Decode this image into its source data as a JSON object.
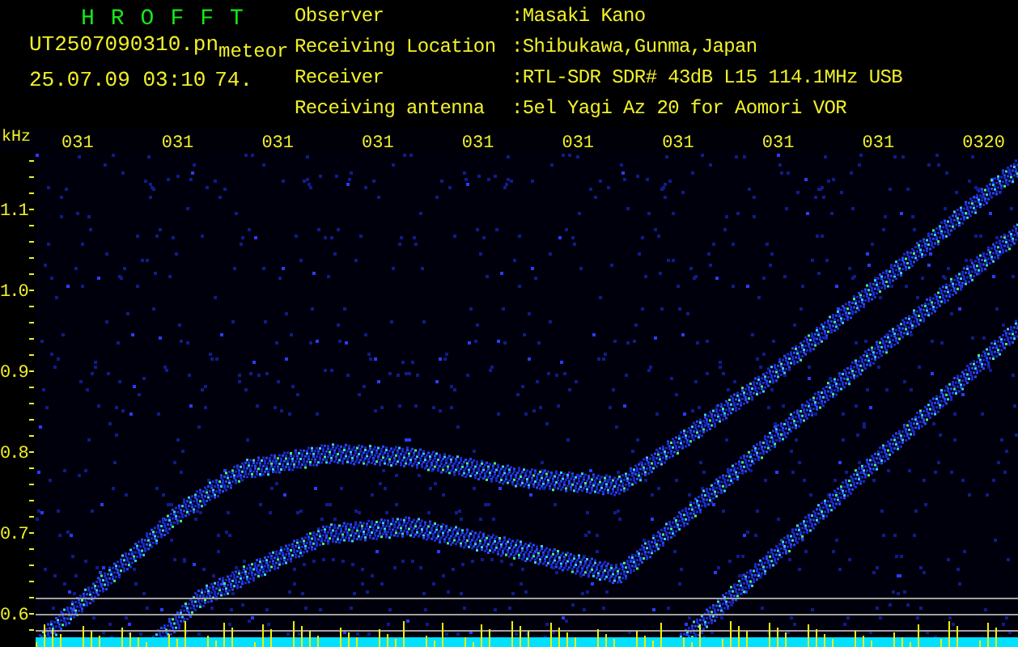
{
  "app": {
    "title": "HROFFT"
  },
  "file": {
    "name": "UT2507090310.pn",
    "type": "meteor",
    "datetime": "25.07.09 03:10",
    "count": "74."
  },
  "info": [
    {
      "label": "Observer",
      "value": ":Masaki Kano"
    },
    {
      "label": "Receiving Location",
      "value": ":Shibukawa,Gunma,Japan"
    },
    {
      "label": "Receiver",
      "value": ":RTL-SDR SDR# 43dB L15 114.1MHz USB"
    },
    {
      "label": "Receiving antenna",
      "value": ":5el Yagi Az 20 for Aomori VOR"
    }
  ],
  "plot": {
    "unit": "kHz",
    "time_labels": [
      "031",
      "031",
      "031",
      "031",
      "031",
      "031",
      "031",
      "031",
      "031",
      "0320"
    ],
    "freq_labels": [
      "1.1",
      "1.0",
      "0.9",
      "0.8",
      "0.7",
      "0.6"
    ]
  }
}
